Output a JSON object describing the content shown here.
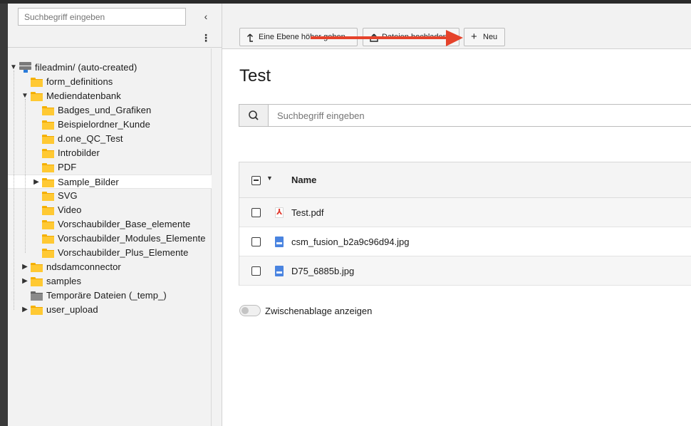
{
  "sidebar": {
    "search_placeholder": "Suchbegriff eingeben",
    "collapse_icon": "‹",
    "more_icon": "⋮",
    "tree": [
      {
        "label": "fileadmin/ (auto-created)",
        "icon": "storage-icon",
        "toggle": "▼",
        "level": 0,
        "selected": false
      },
      {
        "label": "form_definitions",
        "icon": "folder-icon",
        "toggle": "",
        "level": 1,
        "selected": false
      },
      {
        "label": "Mediendatenbank",
        "icon": "folder-icon",
        "toggle": "▼",
        "level": 1,
        "selected": false
      },
      {
        "label": "Badges_und_Grafiken",
        "icon": "folder-icon",
        "toggle": "",
        "level": 2,
        "selected": false
      },
      {
        "label": "Beispielordner_Kunde",
        "icon": "folder-icon",
        "toggle": "",
        "level": 2,
        "selected": false
      },
      {
        "label": "d.one_QC_Test",
        "icon": "folder-icon",
        "toggle": "",
        "level": 2,
        "selected": false
      },
      {
        "label": "Introbilder",
        "icon": "folder-icon",
        "toggle": "",
        "level": 2,
        "selected": false
      },
      {
        "label": "PDF",
        "icon": "folder-icon",
        "toggle": "",
        "level": 2,
        "selected": false
      },
      {
        "label": "Sample_Bilder",
        "icon": "folder-icon",
        "toggle": "▶",
        "level": 2,
        "selected": true
      },
      {
        "label": "SVG",
        "icon": "folder-icon",
        "toggle": "",
        "level": 2,
        "selected": false
      },
      {
        "label": "Video",
        "icon": "folder-icon",
        "toggle": "",
        "level": 2,
        "selected": false
      },
      {
        "label": "Vorschaubilder_Base_elemente",
        "icon": "folder-icon",
        "toggle": "",
        "level": 2,
        "selected": false
      },
      {
        "label": "Vorschaubilder_Modules_Elemente",
        "icon": "folder-icon",
        "toggle": "",
        "level": 2,
        "selected": false
      },
      {
        "label": "Vorschaubilder_Plus_Elemente",
        "icon": "folder-icon",
        "toggle": "",
        "level": 2,
        "selected": false
      },
      {
        "label": "ndsdamconnector",
        "icon": "folder-icon",
        "toggle": "▶",
        "level": 1,
        "selected": false
      },
      {
        "label": "samples",
        "icon": "folder-icon",
        "toggle": "▶",
        "level": 1,
        "selected": false
      },
      {
        "label": "Temporäre Dateien (_temp_)",
        "icon": "folder-grey-icon",
        "toggle": "",
        "level": 1,
        "selected": false
      },
      {
        "label": "user_upload",
        "icon": "folder-icon",
        "toggle": "▶",
        "level": 1,
        "selected": false
      }
    ]
  },
  "toolbar": {
    "up_label": "Eine Ebene höher gehen",
    "up_icon": "⬏",
    "upload_label": "Dateien hochladen",
    "upload_icon": "⤒",
    "new_label": "Neu",
    "new_icon": "+",
    "annotation_arrow_color": "#e5432b"
  },
  "main": {
    "title": "Test",
    "search_placeholder": "Suchbegriff eingeben",
    "search_icon": "search-icon",
    "table": {
      "column_name": "Name",
      "files": [
        {
          "name": "Test.pdf",
          "type": "pdf"
        },
        {
          "name": "csm_fusion_b2a9c96d94.jpg",
          "type": "image"
        },
        {
          "name": "D75_6885b.jpg",
          "type": "image"
        }
      ]
    },
    "clipboard_label": "Zwischenablage anzeigen"
  }
}
